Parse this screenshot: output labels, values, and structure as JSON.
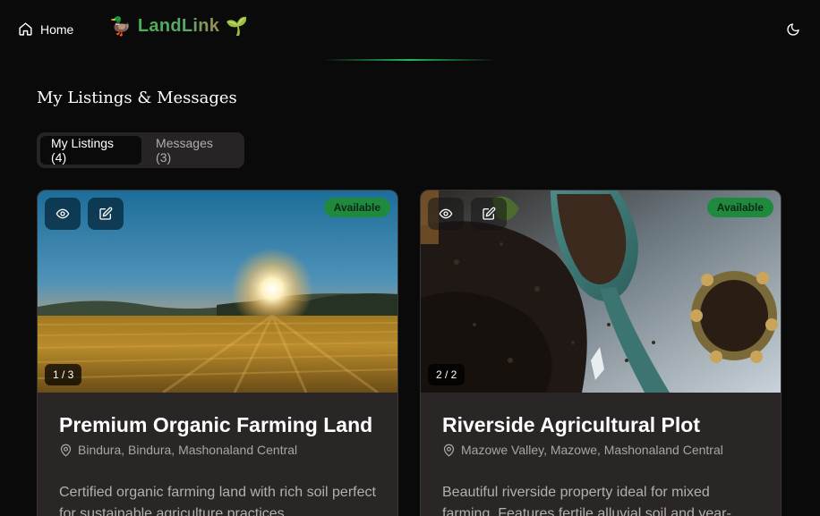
{
  "nav": {
    "home_label": "Home",
    "brand_left_emoji": "🦆",
    "brand_name": "LandLink",
    "brand_right_emoji": "🌱",
    "theme_icon": "moon-icon"
  },
  "page": {
    "title": "My Listings & Messages"
  },
  "tabs": [
    {
      "label": "My Listings (4)",
      "active": true
    },
    {
      "label": "Messages (3)",
      "active": false
    }
  ],
  "listings": [
    {
      "title": "Premium Organic Farming Land",
      "location": "Bindura, Bindura, Mashonaland Central",
      "description": "Certified organic farming land with rich soil perfect for sustainable agriculture practices.",
      "status": "Available",
      "image_counter": "1 / 3"
    },
    {
      "title": "Riverside Agricultural Plot",
      "location": "Mazowe Valley, Mazowe, Mashonaland Central",
      "description": "Beautiful riverside property ideal for mixed farming. Features fertile alluvial soil and year-",
      "status": "Available",
      "image_counter": "2 / 2"
    }
  ],
  "colors": {
    "background": "#0b0a0a",
    "card": "#2a2626",
    "accent_green": "#1f8a3e",
    "brand_green": "#4caf50"
  }
}
